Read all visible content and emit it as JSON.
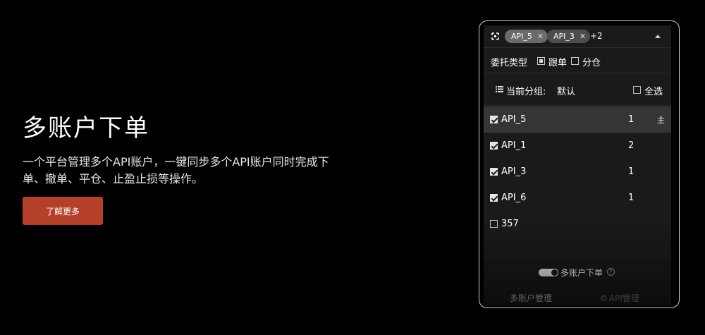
{
  "hero": {
    "title": "多账户下单",
    "description": "一个平台管理多个API账户，一键同步多个API账户同时完成下单、撤单、平仓、止盈止损等操作。",
    "cta_label": "了解更多",
    "cta_color": "#b4402a"
  },
  "panel": {
    "selector": {
      "tags": [
        {
          "label": "API_5"
        },
        {
          "label": "API_3"
        }
      ],
      "more_count": "+2",
      "expand_icon": "expand-icon",
      "collapse_icon": "caret-up-icon"
    },
    "order_type": {
      "label": "委托类型",
      "options": [
        {
          "label": "跟单",
          "checked": true
        },
        {
          "label": "分仓",
          "checked": false
        }
      ]
    },
    "group": {
      "label": "当前分组:",
      "value": "默认",
      "select_all": "全选"
    },
    "accounts": [
      {
        "name": "API_5",
        "count": "1",
        "tag": "主",
        "checked": true
      },
      {
        "name": "API_1",
        "count": "2",
        "tag": "",
        "checked": true
      },
      {
        "name": "API_3",
        "count": "1",
        "tag": "",
        "checked": true
      },
      {
        "name": "API_6",
        "count": "1",
        "tag": "",
        "checked": true
      },
      {
        "name": "357",
        "count": "",
        "tag": "",
        "checked": false
      }
    ],
    "toggle": {
      "label": "多账户下单",
      "on": true
    },
    "tabs": {
      "manage": "多账户管理",
      "api": "API管理"
    }
  }
}
